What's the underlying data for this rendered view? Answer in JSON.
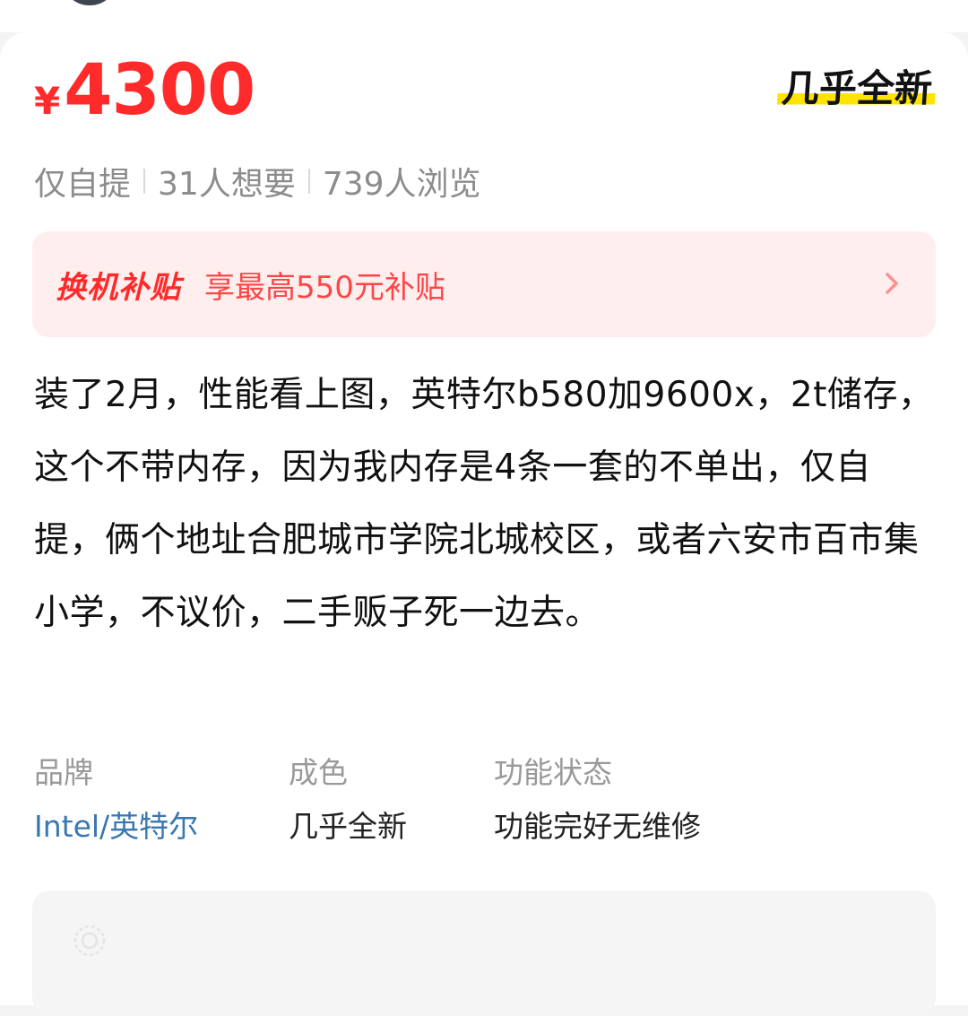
{
  "listing": {
    "price_currency": "¥",
    "price_amount": "4300",
    "condition_badge": "几乎全新",
    "stats": {
      "pickup": "仅自提",
      "wants": "31人想要",
      "views": "739人浏览"
    }
  },
  "subsidy": {
    "tag": "换机补贴",
    "text": "享最高550元补贴"
  },
  "description": "装了2月，性能看上图，英特尔b580加9600x，2t储存，这个不带内存，因为我内存是4条一套的不单出，仅自提，俩个地址合肥城市学院北城校区，或者六安市百市集小学，不议价，二手贩子死一边去。",
  "attributes": [
    {
      "label": "品牌",
      "value": "Intel/英特尔"
    },
    {
      "label": "成色",
      "value": "几乎全新"
    },
    {
      "label": "功能状态",
      "value": "功能完好无维修"
    }
  ],
  "colors": {
    "price": "#ff2a2a",
    "badge_highlight": "#ffe400",
    "subsidy_bg": "#ffeeee",
    "brand_link": "#3a77b0"
  }
}
